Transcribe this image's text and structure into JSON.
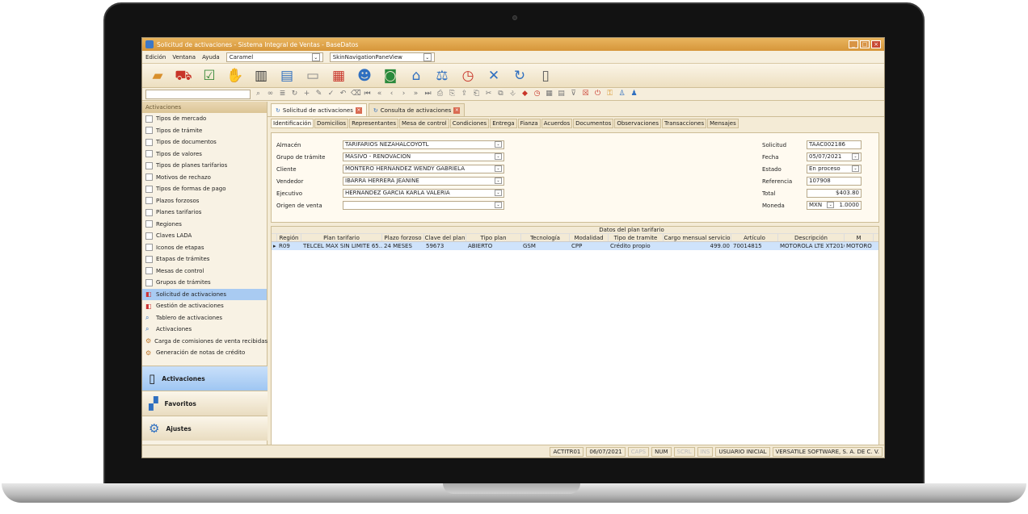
{
  "window": {
    "title": "Solicitud de activaciones - Sistema Integral de Ventas - BaseDatos"
  },
  "menu": {
    "items": [
      "Edición",
      "Ventana",
      "Ayuda"
    ],
    "skin_value": "Caramel",
    "nav_value": "SkinNavigationPaneView"
  },
  "sidebar": {
    "header": "Activaciones",
    "items": [
      {
        "label": "Tipos de mercado",
        "icon": "checkbox"
      },
      {
        "label": "Tipos de trámite",
        "icon": "checkbox"
      },
      {
        "label": "Tipos de documentos",
        "icon": "checkbox"
      },
      {
        "label": "Tipos de valores",
        "icon": "checkbox"
      },
      {
        "label": "Tipos de planes tarifarios",
        "icon": "checkbox"
      },
      {
        "label": "Motivos de rechazo",
        "icon": "checkbox"
      },
      {
        "label": "Tipos de formas de pago",
        "icon": "checkbox"
      },
      {
        "label": "Plazos forzosos",
        "icon": "checkbox"
      },
      {
        "label": "Planes tarifarios",
        "icon": "checkbox"
      },
      {
        "label": "Regiones",
        "icon": "checkbox"
      },
      {
        "label": "Claves LADA",
        "icon": "checkbox"
      },
      {
        "label": "Iconos de etapas",
        "icon": "checkbox"
      },
      {
        "label": "Etapas de trámites",
        "icon": "checkbox"
      },
      {
        "label": "Mesas de control",
        "icon": "checkbox"
      },
      {
        "label": "Grupos de trámites",
        "icon": "checkbox"
      },
      {
        "label": "Solicitud de activaciones",
        "icon": "doc-icon"
      },
      {
        "label": "Gestión de activaciones",
        "icon": "doc-icon"
      },
      {
        "label": "Tablero de activaciones",
        "icon": "search-icon"
      },
      {
        "label": "Activaciones",
        "icon": "search-icon"
      },
      {
        "label": "Carga de comisiones de venta recibidas",
        "icon": "gears-icon"
      },
      {
        "label": "Generación de notas de crédito",
        "icon": "gears-icon"
      }
    ],
    "active_index": 15,
    "nav_panes": [
      "Activaciones",
      "Favoritos",
      "Ajustes"
    ]
  },
  "doc_tabs": [
    "Solicitud de activaciones",
    "Consulta de activaciones"
  ],
  "sub_tabs": [
    "Identificación",
    "Domicilios",
    "Representantes",
    "Mesa de control",
    "Condiciones",
    "Entrega",
    "Fianza",
    "Acuerdos",
    "Documentos",
    "Observaciones",
    "Transacciones",
    "Mensajes"
  ],
  "form": {
    "left": [
      {
        "label": "Almacén",
        "value": "TARIFARIOS NEZAHALCOYOTL"
      },
      {
        "label": "Grupo de trámite",
        "value": "MASIVO - RENOVACION"
      },
      {
        "label": "Cliente",
        "value": "MONTERO HERNANDEZ WENDY GABRIELA"
      },
      {
        "label": "Vendedor",
        "value": "IBARRA HERRERA JEANINE"
      },
      {
        "label": "Ejecutivo",
        "value": "HERNANDEZ GARCIA KARLA VALERIA"
      },
      {
        "label": "Origen de venta",
        "value": ""
      }
    ],
    "right": [
      {
        "label": "Solicitud",
        "value": "TAAC002186"
      },
      {
        "label": "Fecha",
        "value": "05/07/2021"
      },
      {
        "label": "Estado",
        "value": "En proceso"
      },
      {
        "label": "Referencia",
        "value": "107908"
      },
      {
        "label": "Total",
        "value": "$403.80"
      },
      {
        "label": "Moneda",
        "value": "MXN",
        "rate": "1.0000"
      }
    ]
  },
  "grid": {
    "band_label": "Datos del plan tarifario",
    "columns": [
      "Región",
      "Plan tarifario",
      "Plazo forzoso",
      "Clave del plan",
      "Tipo plan",
      "Tecnología",
      "Modalidad",
      "Tipo de tramite",
      "Cargo mensual servicio",
      "Artículo",
      "Descripción",
      "M"
    ],
    "rows": [
      [
        "R09",
        "TELCEL MAX SIN LIMITE 65...",
        "24 MESES",
        "59673",
        "ABIERTO",
        "GSM",
        "CPP",
        "Crédito propio",
        "499.00",
        "70014815",
        "MOTOROLA LTE XT2010-1...",
        "MOTORO"
      ]
    ]
  },
  "status": {
    "user_code": "ACTITR01",
    "date": "06/07/2021",
    "caps": "CAPS",
    "num": "NUM",
    "scrl": "SCRL",
    "ins": "INS",
    "user": "USUARIO INICIAL",
    "company": "VERSATILE SOFTWARE, S. A. DE C. V."
  },
  "colors": {
    "titlebar": "#d6963a",
    "selection": "#a9cbf2",
    "panel": "#f4ebd6"
  }
}
